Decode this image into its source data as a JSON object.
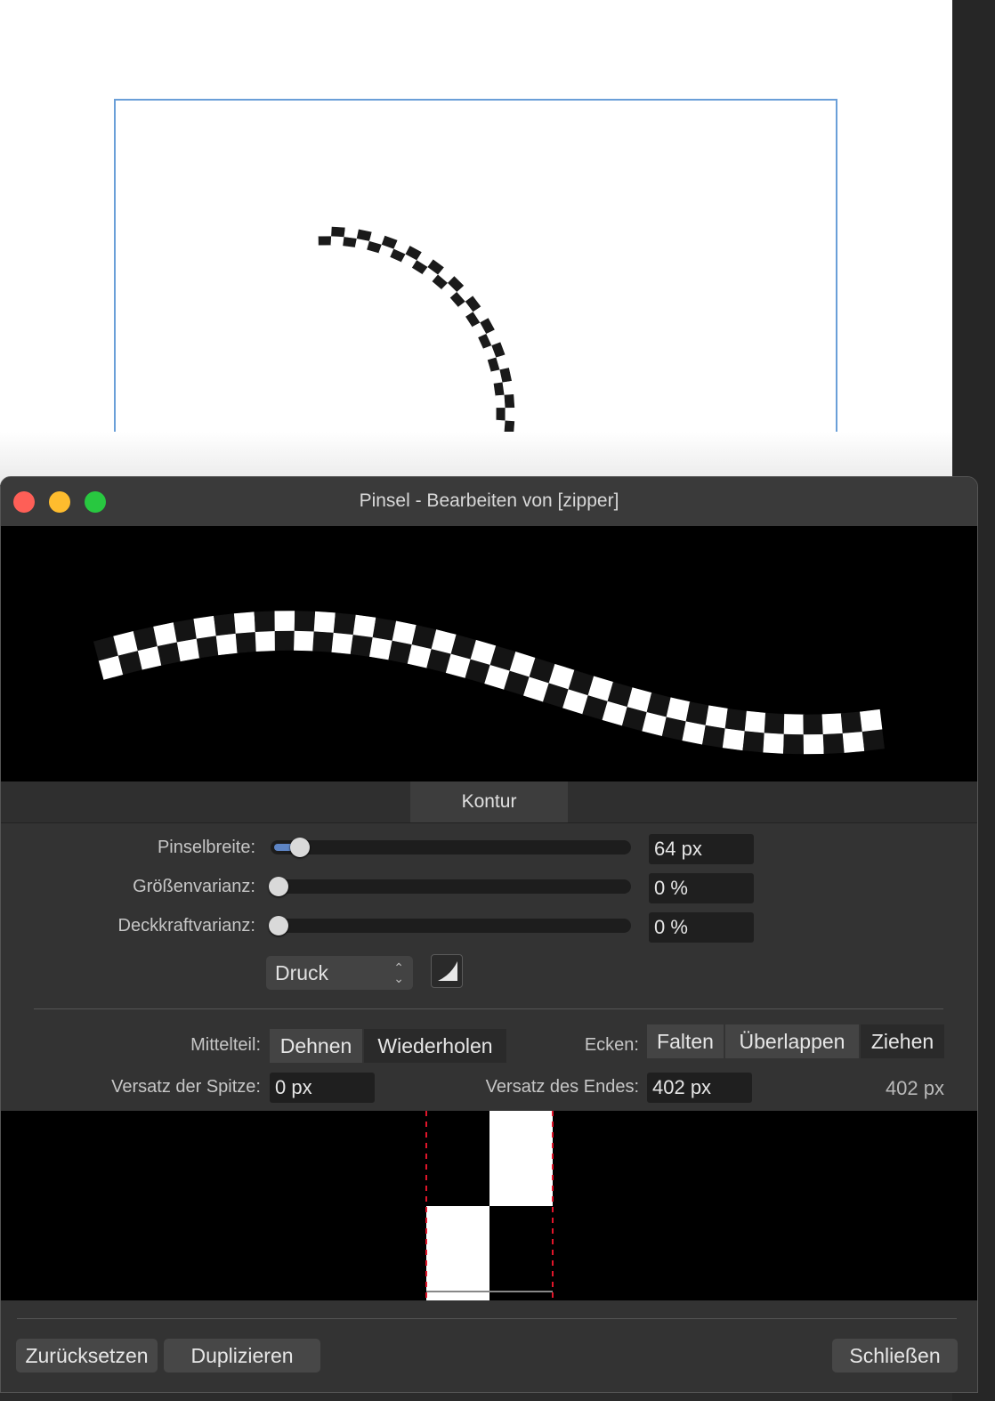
{
  "window": {
    "title": "Pinsel - Bearbeiten von [zipper]"
  },
  "tabs": {
    "active": "Kontur"
  },
  "controls": {
    "brush_width": {
      "label": "Pinselbreite:",
      "value": "64 px",
      "slider_fraction": 0.07
    },
    "size_variance": {
      "label": "Größenvarianz:",
      "value": "0 %",
      "slider_fraction": 0
    },
    "opacity_variance": {
      "label": "Deckkraftvarianz:",
      "value": "0 %",
      "slider_fraction": 0
    },
    "pressure_select": {
      "value": "Druck"
    }
  },
  "middle": {
    "label": "Mittelteil:",
    "options": [
      "Dehnen",
      "Wiederholen"
    ],
    "selected": "Wiederholen"
  },
  "corners": {
    "label": "Ecken:",
    "options": [
      "Falten",
      "Überlappen",
      "Ziehen"
    ],
    "selected": "Ziehen"
  },
  "offsets": {
    "tip_label": "Versatz der Spitze:",
    "tip_value": "0 px",
    "end_label": "Versatz des Endes:",
    "end_value": "402 px",
    "total": "402 px"
  },
  "footer": {
    "reset": "Zurücksetzen",
    "duplicate": "Duplizieren",
    "close": "Schließen"
  },
  "colors": {
    "traffic_close": "#fe5f57",
    "traffic_minimize": "#febc2e",
    "traffic_maximize": "#28c840",
    "artboard_border": "#6a9fd8",
    "slider_fill": "#5d84c4",
    "offset_marker": "#e0152a"
  }
}
